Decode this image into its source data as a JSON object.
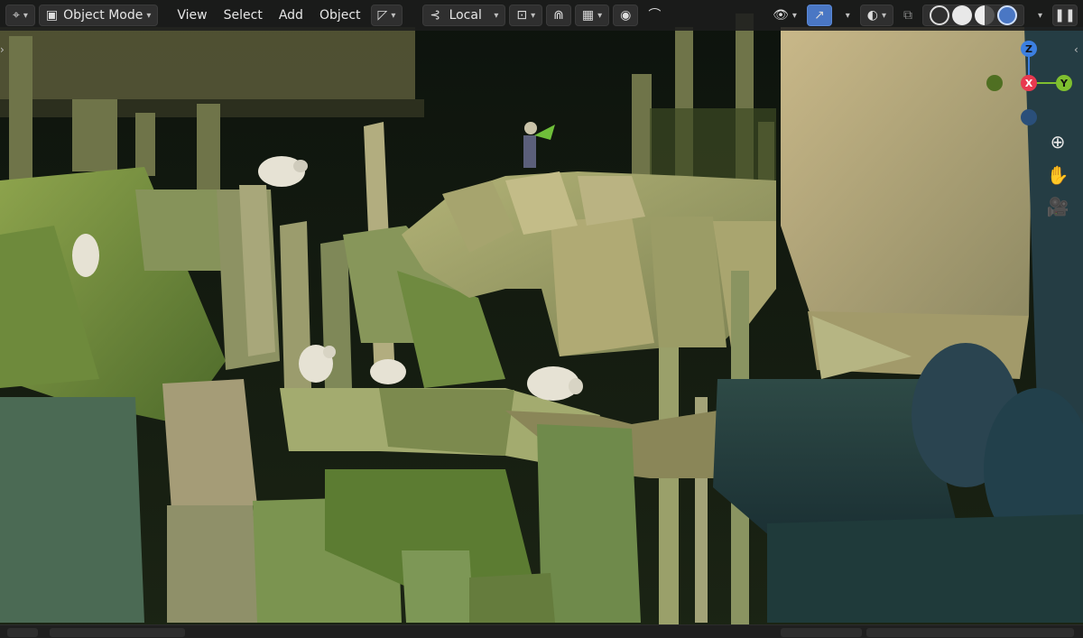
{
  "header": {
    "editor_icon": "3d-viewport-icon",
    "mode_label": "Object Mode",
    "menus": [
      "View",
      "Select",
      "Add",
      "Object"
    ],
    "transform_orientation": "Local",
    "pivot_icon": "pivot-point-icon",
    "snap_icon": "snap-magnet-icon",
    "proportional_icon": "proportional-edit-icon",
    "falloff_icon": "falloff-curve-icon",
    "visibility_icon": "eye-visibility-icon",
    "gizmo_icon": "gizmo-toggle-icon",
    "overlay_icon": "overlays-icon",
    "xray_icon": "xray-icon",
    "shading_modes": [
      "wireframe",
      "solid",
      "material-preview",
      "rendered"
    ],
    "active_shading": "rendered",
    "sidebar_toggle": "pause-style-sidebar-icon"
  },
  "gizmo": {
    "z_label": "Z",
    "x_label": "X",
    "y_label": "Y",
    "colors": {
      "x": "#e8394f",
      "y": "#7fbf2f",
      "z": "#3c7fe0",
      "neg_y": "#4f6f22",
      "neg_x": "#2a4f7a"
    }
  },
  "nav_icons": [
    "zoom-icon",
    "pan-hand-icon",
    "camera-icon"
  ],
  "colors": {
    "accent": "#4a77c4",
    "toolbar_bg": "#1c1c1c"
  }
}
